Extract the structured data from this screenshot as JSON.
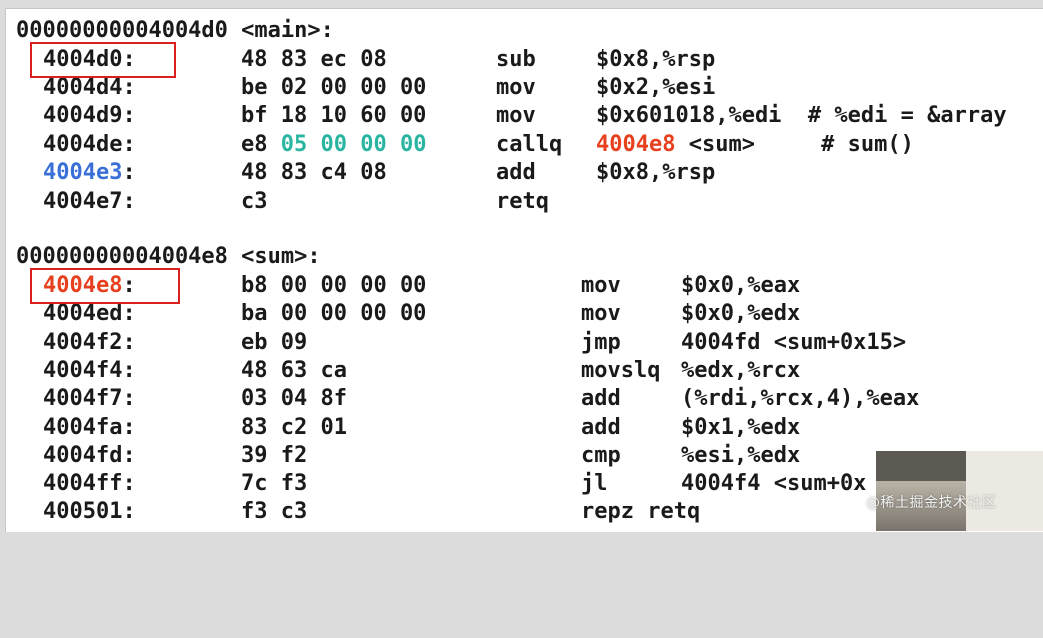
{
  "main": {
    "header": "00000000004004d0 <main>:",
    "rows": [
      {
        "addr": "4004d0:",
        "bytes": "48 83 ec 08",
        "mnem": "sub",
        "ops": "$0x8,%rsp"
      },
      {
        "addr": "4004d4:",
        "bytes": "be 02 00 00 00",
        "mnem": "mov",
        "ops": "$0x2,%esi"
      },
      {
        "addr": "4004d9:",
        "bytes": "bf 18 10 60 00",
        "mnem": "mov",
        "ops": "$0x601018,%edi  # %edi = &array"
      },
      {
        "addr": "4004de:",
        "bytes_prefix": "e8 ",
        "bytes_hl": "05 00 00 00",
        "mnem": "callq",
        "ops_hl": "4004e8",
        "ops_rest": " <sum>     # sum()"
      },
      {
        "addr": "4004e3",
        "addr_suffix": ":",
        "bytes": "48 83 c4 08",
        "mnem": "add",
        "ops": "$0x8,%rsp"
      },
      {
        "addr": "4004e7:",
        "bytes": "c3",
        "mnem": "retq",
        "ops": ""
      }
    ]
  },
  "sum": {
    "header": "00000000004004e8 <sum>:",
    "rows": [
      {
        "addr": "4004e8",
        "addr_suffix": ":",
        "bytes": "b8 00 00 00 00",
        "mnem": "mov",
        "ops": "$0x0,%eax"
      },
      {
        "addr": "4004ed:",
        "bytes": "ba 00 00 00 00",
        "mnem": "mov",
        "ops": "$0x0,%edx"
      },
      {
        "addr": "4004f2:",
        "bytes": "eb 09",
        "mnem": "jmp",
        "ops": "4004fd <sum+0x15>"
      },
      {
        "addr": "4004f4:",
        "bytes": "48 63 ca",
        "mnem": "movslq",
        "ops": "%edx,%rcx"
      },
      {
        "addr": "4004f7:",
        "bytes": "03 04 8f",
        "mnem": "add",
        "ops": "(%rdi,%rcx,4),%eax"
      },
      {
        "addr": "4004fa:",
        "bytes": "83 c2 01",
        "mnem": "add",
        "ops": "$0x1,%edx"
      },
      {
        "addr": "4004fd:",
        "bytes": "39 f2",
        "mnem": "cmp",
        "ops": "%esi,%edx"
      },
      {
        "addr": "4004ff:",
        "bytes": "7c f3",
        "mnem": "jl",
        "ops": "4004f4 <sum+0x"
      },
      {
        "addr": "400501:",
        "bytes": "f3 c3",
        "mnem": "repz retq",
        "ops": ""
      }
    ]
  },
  "watermark": "@稀土掘金技术社区",
  "colors": {
    "highlight_green": "#2ab5a0",
    "highlight_red": "#e6401e",
    "highlight_blue": "#3a6fd8",
    "box_red": "#d92020"
  }
}
